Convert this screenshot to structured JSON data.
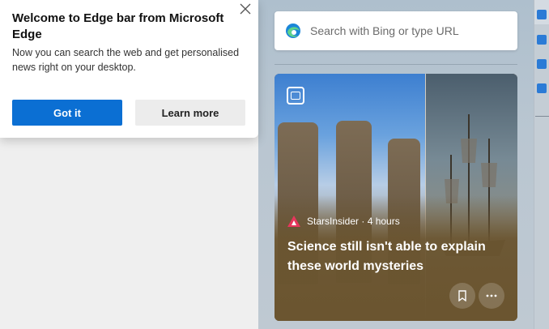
{
  "popup": {
    "title": "Welcome to Edge bar from Microsoft Edge",
    "body": "Now you can search the web and get personalised news right on your desktop.",
    "primary_label": "Got it",
    "secondary_label": "Learn more",
    "close_icon": "close-icon"
  },
  "search": {
    "placeholder": "Search with Bing or type URL",
    "icon": "edge-logo-icon"
  },
  "news_card": {
    "source": "StarsInsider",
    "age": "4 hours",
    "source_line": "StarsInsider · 4 hours",
    "headline": "Science still isn't able to explain these world mysteries",
    "icons": [
      "gallery-icon",
      "bookmark-icon",
      "more-icon"
    ]
  },
  "colors": {
    "primary_button": "#0b6fd3",
    "secondary_button": "#ececec",
    "card_background": "#6b5530",
    "source_logo": "#e8365d"
  }
}
